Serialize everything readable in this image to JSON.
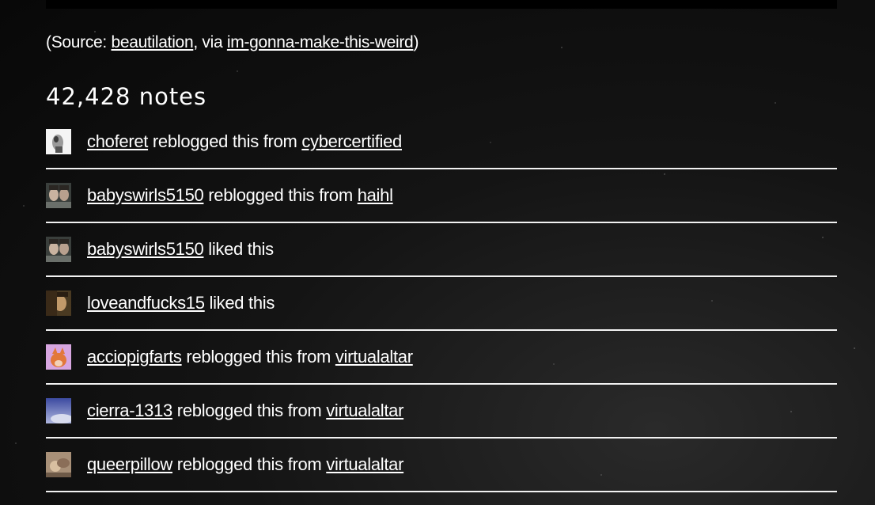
{
  "source": {
    "prefix": "(Source: ",
    "source_user": "beautilation",
    "via_text": ", via ",
    "via_user": "im-gonna-make-this-weird",
    "suffix": ")"
  },
  "notes_count": "42,428 notes",
  "notes": [
    {
      "user": "choferet",
      "action": " reblogged this from ",
      "from": "cybercertified",
      "avatar": "grayscale-figure-avatar",
      "avatar_color": "#d8d8d8"
    },
    {
      "user": "babyswirls5150",
      "action": " reblogged this from ",
      "from": "haihl",
      "avatar": "two-faces-avatar",
      "avatar_color": "#6a6f6a"
    },
    {
      "user": "babyswirls5150",
      "action": " liked this",
      "from": "",
      "avatar": "two-faces-avatar",
      "avatar_color": "#6a6f6a"
    },
    {
      "user": "loveandfucks15",
      "action": " liked this",
      "from": "",
      "avatar": "portrait-avatar",
      "avatar_color": "#5a4a30"
    },
    {
      "user": "acciopigfarts",
      "action": " reblogged this from ",
      "from": "virtualaltar",
      "avatar": "fox-avatar",
      "avatar_color": "#c88fd0"
    },
    {
      "user": "cierra-1313",
      "action": " reblogged this from ",
      "from": "virtualaltar",
      "avatar": "sky-avatar",
      "avatar_color": "#7c83b8"
    },
    {
      "user": "queerpillow",
      "action": " reblogged this from ",
      "from": "virtualaltar",
      "avatar": "beige-avatar",
      "avatar_color": "#b8a08a"
    }
  ]
}
